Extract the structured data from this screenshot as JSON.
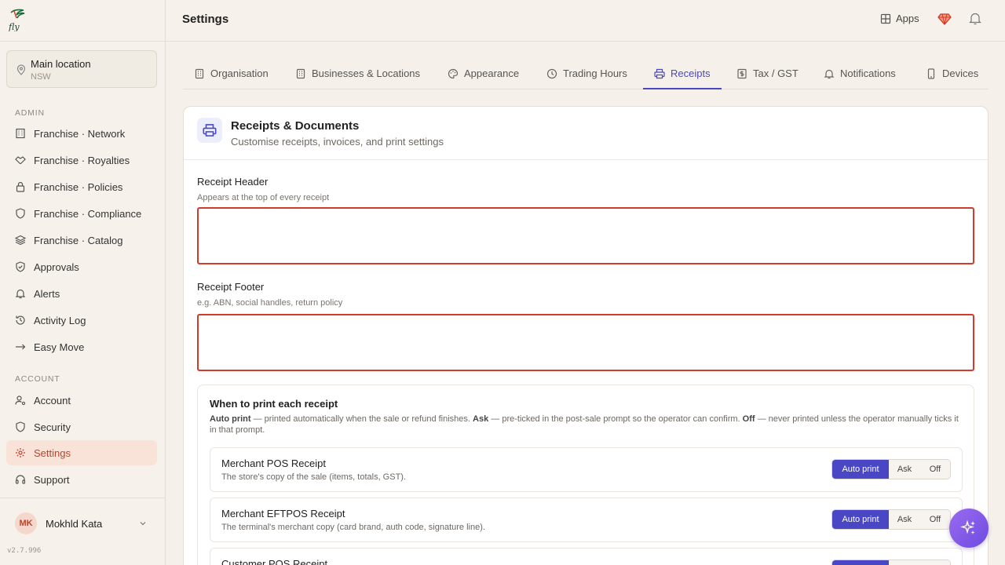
{
  "app": {
    "logo_text": "Fly",
    "version": "v2.7.996"
  },
  "location": {
    "name": "Main location",
    "region": "NSW"
  },
  "sidebar": {
    "admin_label": "ADMIN",
    "admin_items": [
      {
        "label": "Franchise · Network",
        "icon": "building-icon"
      },
      {
        "label": "Franchise · Royalties",
        "icon": "handshake-icon"
      },
      {
        "label": "Franchise · Policies",
        "icon": "lock-icon"
      },
      {
        "label": "Franchise · Compliance",
        "icon": "shield-icon"
      },
      {
        "label": "Franchise · Catalog",
        "icon": "layers-icon"
      },
      {
        "label": "Approvals",
        "icon": "shield-check-icon"
      },
      {
        "label": "Alerts",
        "icon": "bell-icon"
      },
      {
        "label": "Activity Log",
        "icon": "history-icon"
      },
      {
        "label": "Easy Move",
        "icon": "arrow-right-icon"
      }
    ],
    "account_label": "ACCOUNT",
    "account_items": [
      {
        "label": "Account",
        "icon": "user-cog-icon"
      },
      {
        "label": "Security",
        "icon": "shield-icon"
      },
      {
        "label": "Settings",
        "icon": "gear-icon",
        "active": true
      },
      {
        "label": "Support",
        "icon": "headset-icon"
      }
    ]
  },
  "user": {
    "initials": "MK",
    "name": "Mokhld Kata"
  },
  "header": {
    "title": "Settings",
    "apps_label": "Apps"
  },
  "tabs": [
    {
      "label": "Organisation",
      "icon": "building-icon"
    },
    {
      "label": "Businesses & Locations",
      "icon": "building-icon"
    },
    {
      "label": "Appearance",
      "icon": "palette-icon"
    },
    {
      "label": "Trading Hours",
      "icon": "clock-icon"
    },
    {
      "label": "Receipts",
      "icon": "printer-icon",
      "active": true
    },
    {
      "label": "Tax / GST",
      "icon": "receipt-dollar-icon"
    },
    {
      "label": "Notifications",
      "icon": "bell-icon"
    },
    {
      "label": "Devices",
      "icon": "phone-icon"
    }
  ],
  "card": {
    "title": "Receipts & Documents",
    "subtitle": "Customise receipts, invoices, and print settings",
    "header_field": {
      "label": "Receipt Header",
      "help": "Appears at the top of every receipt",
      "value": ""
    },
    "footer_field": {
      "label": "Receipt Footer",
      "help": "e.g. ABN, social handles, return policy",
      "value": ""
    },
    "print": {
      "title": "When to print each receipt",
      "desc_auto": "Auto print",
      "desc_auto_text": " — printed automatically when the sale or refund finishes. ",
      "desc_ask": "Ask",
      "desc_ask_text": " — pre-ticked in the post-sale prompt so the operator can confirm. ",
      "desc_off": "Off",
      "desc_off_text": " — never printed unless the operator manually ticks it in that prompt.",
      "options": {
        "auto": "Auto print",
        "ask": "Ask",
        "off": "Off"
      },
      "receipts": [
        {
          "name": "Merchant POS Receipt",
          "desc": "The store's copy of the sale (items, totals, GST).",
          "selected": "Auto print"
        },
        {
          "name": "Merchant EFTPOS Receipt",
          "desc": "The terminal's merchant copy (card brand, auth code, signature line).",
          "selected": "Auto print"
        },
        {
          "name": "Customer POS Receipt",
          "desc": "",
          "selected": "Auto print"
        }
      ]
    }
  },
  "colors": {
    "accent": "#4a47c4",
    "brand": "#c2422b",
    "error": "#d23a2a"
  }
}
